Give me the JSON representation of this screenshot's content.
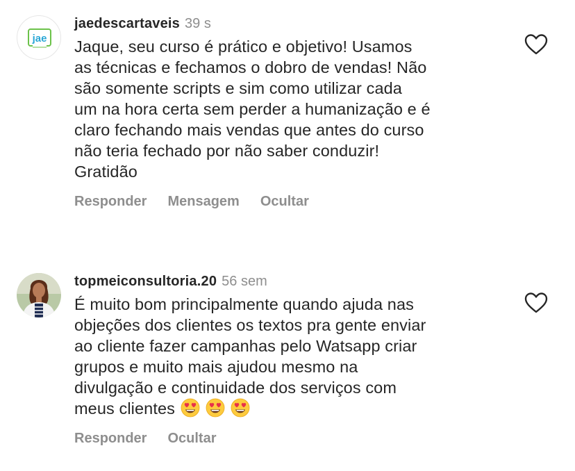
{
  "comments": [
    {
      "username": "jaedescartaveis",
      "time": "39 s",
      "avatar_text": "jae",
      "text": "Jaque, seu curso é prático e objetivo! Usamos\nas técnicas e fechamos o dobro de vendas! Não\nsão somente scripts e sim como utilizar cada\num na hora certa sem perder a humanização e é\nclaro fechando mais vendas que antes do curso\nnão teria fechado por não saber conduzir!\nGratidão",
      "actions": {
        "reply": "Responder",
        "message": "Mensagem",
        "hide": "Ocultar"
      }
    },
    {
      "username": "topmeiconsultoria.20",
      "time": "56 sem",
      "text": "É muito bom principalmente quando ajuda nas\nobjeções dos clientes os textos pra gente enviar\nao cliente fazer campanhas pelo Watsapp criar\ngrupos e muito mais ajudou mesmo na\ndivulgação e continuidade dos serviços com\nmeus clientes",
      "emojis": [
        "heart-eyes-emoji",
        "heart-eyes-emoji",
        "heart-eyes-emoji"
      ],
      "actions": {
        "reply": "Responder",
        "hide": "Ocultar"
      }
    }
  ],
  "icons": {
    "like": "heart-outline-icon"
  },
  "colors": {
    "text": "#262626",
    "secondary": "#8e8e8e",
    "logo_green": "#6cc24a",
    "logo_blue": "#2aa7d6"
  }
}
